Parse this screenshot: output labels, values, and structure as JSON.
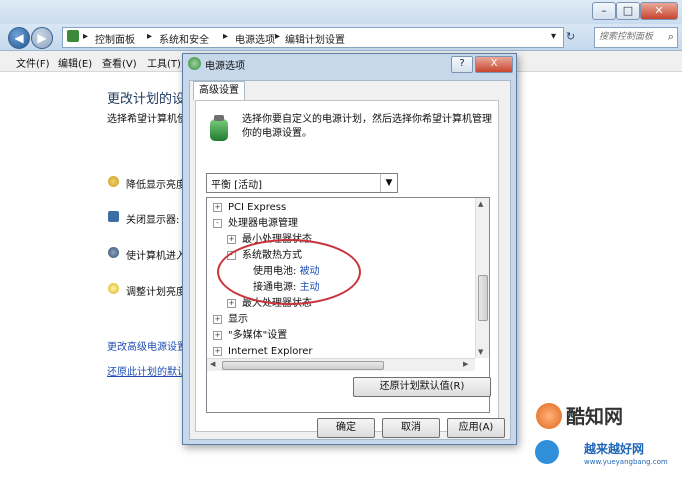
{
  "window": {
    "nav": {
      "back": "◀",
      "forward": "▶"
    },
    "breadcrumbs": [
      "控制面板",
      "系统和安全",
      "电源选项",
      "编辑计划设置"
    ],
    "search_placeholder": "搜索控制面板",
    "menu": [
      "文件(F)",
      "编辑(E)",
      "查看(V)",
      "工具(T)"
    ]
  },
  "background": {
    "title": "更改计划的设",
    "subtitle": "选择希望计算机使",
    "settings": [
      "降低显示亮度",
      "关闭显示器:",
      "使计算机进入",
      "调整计划亮度"
    ],
    "links": [
      "更改高级电源设置",
      "还原此计划的默认"
    ]
  },
  "dialog": {
    "title": "电源选项",
    "help": "?",
    "close": "X",
    "tab": "高级设置",
    "description": [
      "选择你要自定义的电源计划，然后选择你希望计算机管理",
      "你的电源设置。"
    ],
    "plan": "平衡 [活动]",
    "tree": [
      {
        "label": "PCI Express",
        "toggle": "+"
      },
      {
        "label": "处理器电源管理",
        "toggle": "-"
      },
      {
        "label": "最小处理器状态",
        "toggle": "+"
      },
      {
        "label": "系统散热方式",
        "toggle": "-"
      },
      {
        "label": "使用电池:",
        "value": "被动"
      },
      {
        "label": "接通电源:",
        "value": "主动"
      },
      {
        "label": "最大处理器状态",
        "toggle": "+"
      },
      {
        "label": "显示",
        "toggle": "+"
      },
      {
        "label": "\"多媒体\"设置",
        "toggle": "+"
      },
      {
        "label": "Internet Explorer",
        "toggle": "+"
      }
    ],
    "restore_button": "还原计划默认值(R)",
    "ok_button": "确定",
    "cancel_button": "取消",
    "apply_button": "应用(A)"
  },
  "watermark": {
    "brand": "酷知网",
    "site_cn": "越来越好网",
    "site_url": "www.yueyangbang.com"
  },
  "colors": {
    "link": "#1f4fb4",
    "annotation": "#c8343a",
    "dialog_frame": "#c7d8ea"
  }
}
